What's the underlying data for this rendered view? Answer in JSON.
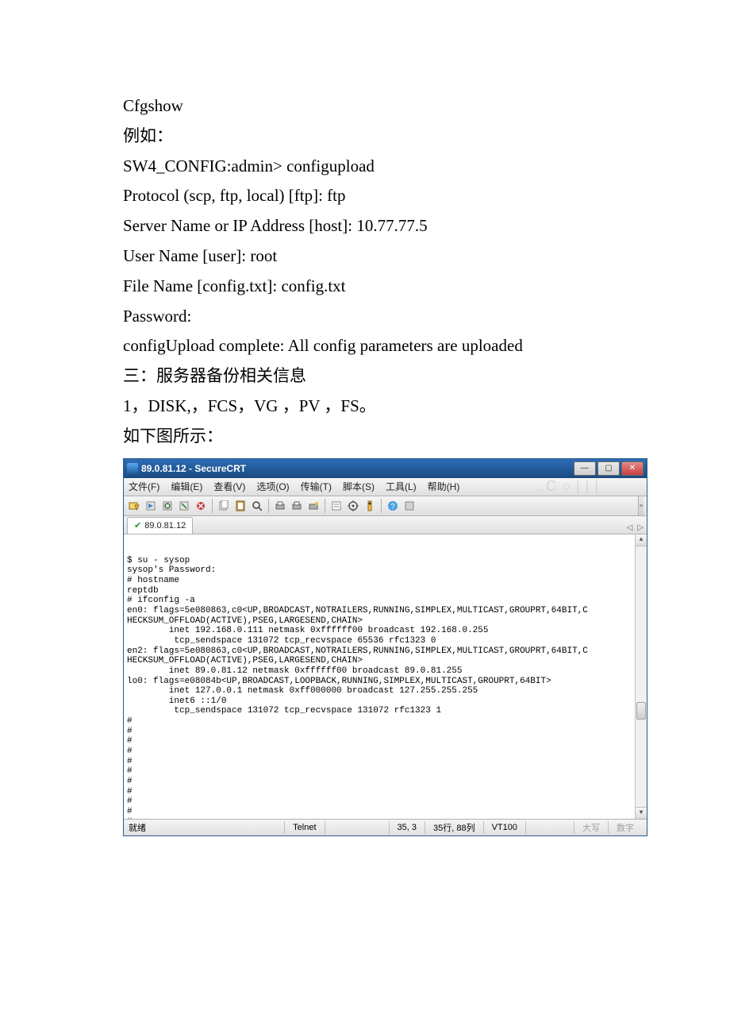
{
  "doc": {
    "l1": "Cfgshow",
    "l2": "例如：",
    "l3": "SW4_CONFIG:admin> configupload",
    "l4": "Protocol (scp, ftp, local) [ftp]: ftp",
    "l5": "Server Name or IP Address [host]: 10.77.77.5",
    "l6": "User Name [user]: root",
    "l7": "File Name [config.txt]: config.txt",
    "l8": "Password:",
    "l9": "configUpload complete: All config parameters are uploaded",
    "l10": "三：服务器备份相关信息",
    "l11": "1，DISK,，FCS，VG ，PV ，FS。",
    "l12": "如下图所示："
  },
  "window": {
    "title": "89.0.81.12 - SecureCRT",
    "btn_min": "—",
    "btn_max": "▢",
    "btn_close": "✕"
  },
  "menu": {
    "file": "文件(F)",
    "edit": "编辑(E)",
    "view": "查看(V)",
    "options": "选项(O)",
    "transfer": "传输(T)",
    "script": "脚本(S)",
    "tools": "工具(L)",
    "help": "帮助(H)"
  },
  "tab": {
    "name": "89.0.81.12",
    "arrow_left": "◁",
    "arrow_right": "▷"
  },
  "terminal": {
    "output": "$ su - sysop\nsysop's Password:\n# hostname\nreptdb\n# ifconfig -a\nen0: flags=5e080863,c0<UP,BROADCAST,NOTRAILERS,RUNNING,SIMPLEX,MULTICAST,GROUPRT,64BIT,C\nHECKSUM_OFFLOAD(ACTIVE),PSEG,LARGESEND,CHAIN>\n        inet 192.168.0.111 netmask 0xffffff00 broadcast 192.168.0.255\n         tcp_sendspace 131072 tcp_recvspace 65536 rfc1323 0\nen2: flags=5e080863,c0<UP,BROADCAST,NOTRAILERS,RUNNING,SIMPLEX,MULTICAST,GROUPRT,64BIT,C\nHECKSUM_OFFLOAD(ACTIVE),PSEG,LARGESEND,CHAIN>\n        inet 89.0.81.12 netmask 0xffffff00 broadcast 89.0.81.255\nlo0: flags=e08084b<UP,BROADCAST,LOOPBACK,RUNNING,SIMPLEX,MULTICAST,GROUPRT,64BIT>\n        inet 127.0.0.1 netmask 0xff000000 broadcast 127.255.255.255\n        inet6 ::1/0\n         tcp_sendspace 131072 tcp_recvspace 131072 rfc1323 1\n#\n#\n#\n#\n#\n#\n#\n#\n#\n#\n#\n#\n#\n#\n#\n#\n#\n#"
  },
  "status": {
    "ready": "就绪",
    "protocol": "Telnet",
    "pos": "35,  3",
    "dim": "35行, 88列",
    "term": "VT100",
    "caps": "大写",
    "num": "数字"
  }
}
